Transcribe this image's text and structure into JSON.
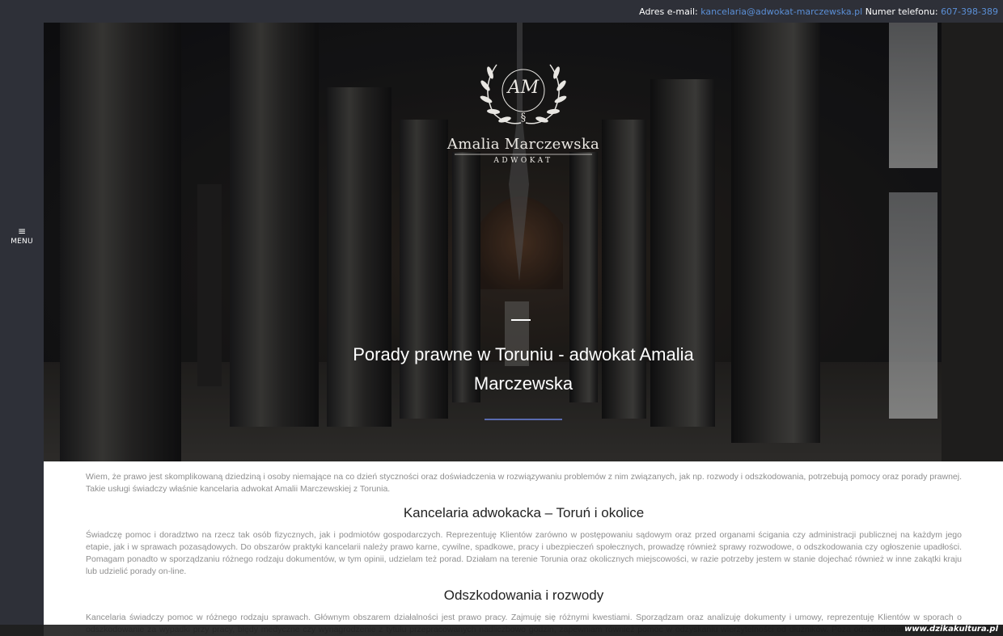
{
  "topbar": {
    "email_label": "Adres e-mail:",
    "email": "kancelaria@adwokat-marczewska.pl",
    "phone_label": "Numer telefonu:",
    "phone": "607-398-389",
    "link_color": "#5b8fd6"
  },
  "sidebar": {
    "menu_icon": "hamburger-icon",
    "menu_label": "MENU"
  },
  "logo": {
    "monogram": "AM",
    "section_sign": "§",
    "name": "Amalia Marczewska",
    "subtitle": "ADWOKAT"
  },
  "hero": {
    "title": "Porady prawne w Toruniu - adwokat Amalia Marczewska",
    "accent_line_color": "#5a6bb0"
  },
  "content": {
    "intro": "Wiem, że prawo jest skomplikowaną dziedziną i osoby niemające na co dzień styczności oraz doświadczenia w rozwiązywaniu problemów z nim związanych, jak np. rozwody i odszkodowania, potrzebują pomocy oraz porady prawnej. Takie usługi świadczy właśnie kancelaria adwokat Amalii Marczewskiej z Torunia.",
    "section1_title": "Kancelaria adwokacka – Toruń i okolice",
    "section1_text": "Świadczę pomoc i doradztwo na rzecz tak osób fizycznych, jak i podmiotów gospodarczych. Reprezentuję Klientów zarówno w postępowaniu sądowym oraz przed organami ścigania czy administracji publicznej na każdym jego etapie, jak i w sprawach pozasądowych. Do obszarów praktyki kancelarii należy prawo karne, cywilne, spadkowe, pracy i ubezpieczeń społecznych, prowadzę również sprawy rozwodowe, o odszkodowania czy ogłoszenie upadłości. Pomagam ponadto w sporządzaniu różnego rodzaju dokumentów, w tym opinii, udzielam też porad. Działam na terenie Torunia oraz okolicznych miejscowości, w razie potrzeby jestem w stanie dojechać również w inne zakątki kraju lub udzielić porady on-line.",
    "section2_title": "Odszkodowania i rozwody",
    "section2_text": "Kancelaria świadczy pomoc w różnego rodzaju sprawach. Głównym obszarem działalności jest prawo pracy. Zajmuję się różnymi kwestiami. Sporządzam oraz analizuję dokumenty i umowy, reprezentuję Klientów w sporach o odszkodowanie za wypadki przy pracy, błędy medyczne czy wynagrodzenie z tytułu przepracowanych nadliczbowo godzin, zapewniam również pomoc w odzyskaniu wierzytelności od dłużników. Poza odszkodowaniami obszarem działania kancelarii jest prawo rodzinne i spadkowe, w tym zwłaszcza rozwody. Wiem, że przejście przez ten proces w sposób bezproblemowy jest niekiedy trudne. Właśnie dlatego udzielam porad w kwestii rozwodu, separacji, unieważnienia małżeństwa,"
  },
  "watermark": "www.dzikakultura.pl"
}
